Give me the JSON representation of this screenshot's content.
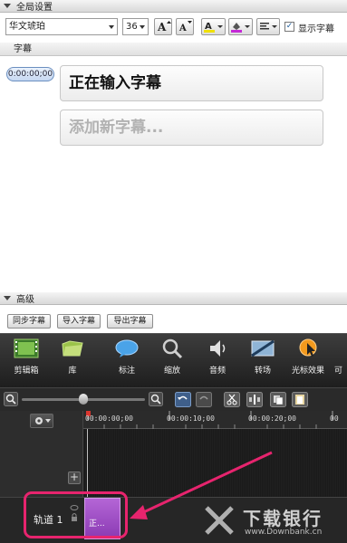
{
  "global_settings": {
    "title": "全局设置",
    "font_value": "华文琥珀",
    "size_value": "36",
    "show_captions_label": "显示字幕",
    "show_captions_checked": true
  },
  "captions_panel": {
    "column_header": "字幕",
    "entries": [
      {
        "time": "0:00:00;00",
        "text": "正在输入字幕"
      }
    ],
    "add_placeholder": "添加新字幕..."
  },
  "advanced": {
    "title": "高级",
    "buttons": [
      "同步字幕",
      "导入字幕",
      "导出字幕"
    ]
  },
  "toolbar": {
    "items": [
      {
        "label": "剪辑箱",
        "icon": "film-strip-icon"
      },
      {
        "label": "库",
        "icon": "folder-icon"
      },
      {
        "label": "标注",
        "icon": "speech-bubble-icon"
      },
      {
        "label": "缩放",
        "icon": "magnifier-icon"
      },
      {
        "label": "音频",
        "icon": "speaker-icon"
      },
      {
        "label": "转场",
        "icon": "transition-icon"
      },
      {
        "label": "光标效果",
        "icon": "cursor-effect-icon"
      },
      {
        "label": "可",
        "icon": "more-icon"
      }
    ]
  },
  "timeline": {
    "ruler_labels": [
      "00:00:00;00",
      "00:00:10;00",
      "00:00:20;00",
      "00"
    ],
    "track_label": "轨道 1",
    "clip_label": "正..."
  },
  "watermark": {
    "title": "下载银行",
    "url": "www.Downbank.cn"
  },
  "colors": {
    "highlight": "#e7246e",
    "clip": "#a34fc9"
  }
}
